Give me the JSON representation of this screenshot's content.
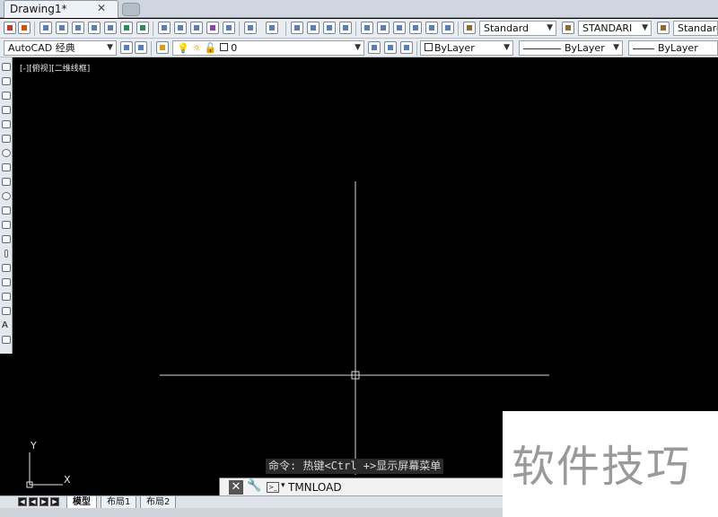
{
  "document_tab": {
    "title": "Drawing1*",
    "close_glyph": "✕"
  },
  "toolbar1": {
    "text_style": "Standard",
    "dim_style": "STANDARI",
    "table_style": "Standard"
  },
  "toolbar2": {
    "workspace": "AutoCAD 经典",
    "layer_value": "0",
    "color": "ByLayer",
    "linetype": "ByLayer",
    "lineweight": "ByLayer"
  },
  "viewport": {
    "label": "[-][俯视][二维线框]",
    "ucs_y": "Y",
    "ucs_x": "X"
  },
  "layout_tabs": [
    "模型",
    "布局1",
    "布局2"
  ],
  "command": {
    "hint": "命令: 热键<Ctrl +>显示屏幕菜单",
    "input_value": "TMNLOAD",
    "prompt_icon": ">_",
    "close_glyph": "✕"
  },
  "watermark": {
    "text": "软件技巧"
  },
  "colors": {
    "canvas": "#000000",
    "crosshair": "#d9d9d9",
    "accent": "#5a7fb0"
  }
}
